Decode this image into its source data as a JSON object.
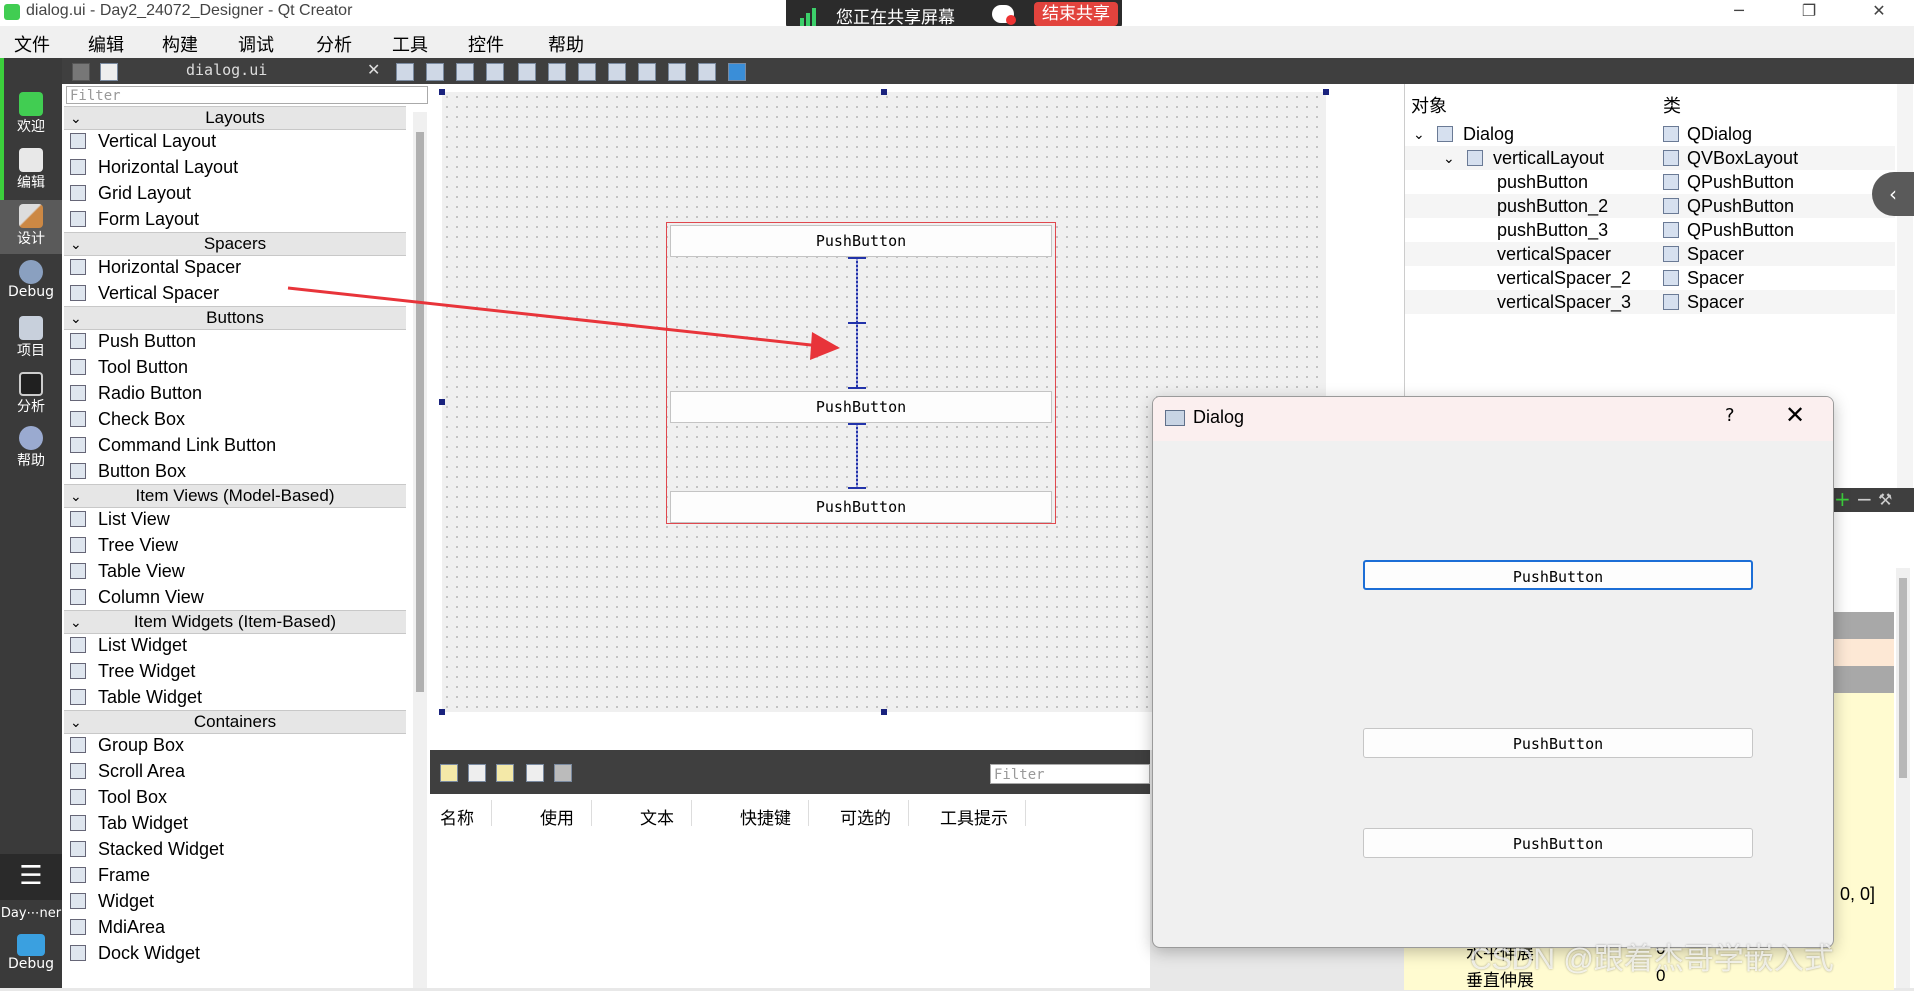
{
  "window": {
    "title": "dialog.ui - Day2_24072_Designer - Qt Creator"
  },
  "share_banner": {
    "text": "您正在共享屏幕",
    "stop_label": "结束共享"
  },
  "menubar": {
    "items": [
      "文件",
      "编辑",
      "构建",
      "调试",
      "分析",
      "工具",
      "控件",
      "帮助"
    ]
  },
  "modebar": {
    "items": [
      {
        "label": "欢迎",
        "icon": "qt-logo-icon"
      },
      {
        "label": "编辑",
        "icon": "edit-document-icon"
      },
      {
        "label": "设计",
        "icon": "design-pen-icon"
      },
      {
        "label": "Debug",
        "icon": "bug-icon"
      },
      {
        "label": "项目",
        "icon": "project-icon"
      },
      {
        "label": "分析",
        "icon": "analyze-icon"
      },
      {
        "label": "帮助",
        "icon": "help-icon"
      }
    ],
    "kit_label": "Day⋯ner",
    "run_label": "Debug"
  },
  "editor_toolbar": {
    "document": "dialog.ui"
  },
  "widget_box": {
    "filter_placeholder": "Filter",
    "categories": [
      {
        "name": "Layouts",
        "items": [
          "Vertical Layout",
          "Horizontal Layout",
          "Grid Layout",
          "Form Layout"
        ]
      },
      {
        "name": "Spacers",
        "items": [
          "Horizontal Spacer",
          "Vertical Spacer"
        ]
      },
      {
        "name": "Buttons",
        "items": [
          "Push Button",
          "Tool Button",
          "Radio Button",
          "Check Box",
          "Command Link Button",
          "Button Box"
        ]
      },
      {
        "name": "Item Views (Model-Based)",
        "items": [
          "List View",
          "Tree View",
          "Table View",
          "Column View"
        ]
      },
      {
        "name": "Item Widgets (Item-Based)",
        "items": [
          "List Widget",
          "Tree Widget",
          "Table Widget"
        ]
      },
      {
        "name": "Containers",
        "items": [
          "Group Box",
          "Scroll Area",
          "Tool Box",
          "Tab Widget",
          "Stacked Widget",
          "Frame",
          "Widget",
          "MdiArea",
          "Dock Widget"
        ]
      }
    ]
  },
  "form": {
    "buttons": [
      "PushButton",
      "PushButton",
      "PushButton"
    ]
  },
  "action_editor": {
    "filter_placeholder": "Filter",
    "columns": [
      "名称",
      "使用",
      "文本",
      "快捷键",
      "可选的",
      "工具提示"
    ]
  },
  "object_inspector": {
    "headers": [
      "对象",
      "类"
    ],
    "rows": [
      {
        "object": "Dialog",
        "class": "QDialog",
        "depth": 0
      },
      {
        "object": "verticalLayout",
        "class": "QVBoxLayout",
        "depth": 1
      },
      {
        "object": "pushButton",
        "class": "QPushButton",
        "depth": 2
      },
      {
        "object": "pushButton_2",
        "class": "QPushButton",
        "depth": 2
      },
      {
        "object": "pushButton_3",
        "class": "QPushButton",
        "depth": 2
      },
      {
        "object": "verticalSpacer",
        "class": "Spacer",
        "depth": 2
      },
      {
        "object": "verticalSpacer_2",
        "class": "Spacer",
        "depth": 2
      },
      {
        "object": "verticalSpacer_3",
        "class": "Spacer",
        "depth": 2
      }
    ]
  },
  "property_editor": {
    "value_snippet": ", 0, 0]",
    "row1_name": "水平伸展",
    "row1_value": "0",
    "row2_name": "垂直伸展",
    "row2_value": "0"
  },
  "dialog_preview": {
    "title": "Dialog",
    "help": "?",
    "close": "✕",
    "buttons": [
      "PushButton",
      "PushButton",
      "PushButton"
    ]
  },
  "watermark": "CSDN @跟着杰哥学嵌入式"
}
